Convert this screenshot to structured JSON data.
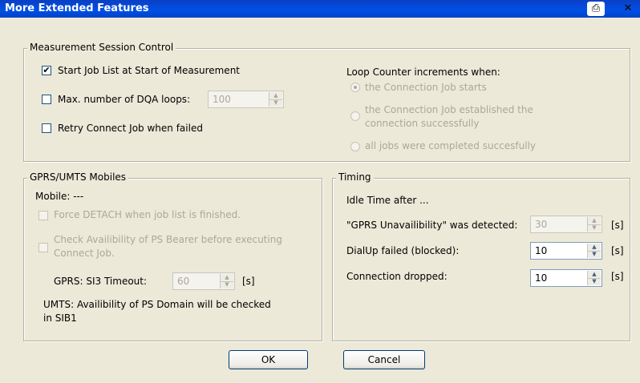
{
  "window": {
    "title": "More Extended Features"
  },
  "measurement": {
    "group_title": "Measurement Session Control",
    "start_job_list": {
      "label": "Start Job List at Start of Measurement",
      "checked": true
    },
    "max_dqa": {
      "label": "Max. number of DQA loops:",
      "checked": false,
      "value": "100"
    },
    "retry_connect": {
      "label": "Retry Connect Job when failed",
      "checked": false
    },
    "loop_counter": {
      "title": "Loop Counter increments when:",
      "options": [
        {
          "label": "the Connection Job starts",
          "selected": true
        },
        {
          "label_line1": "the Connection Job established the",
          "label_line2": "connection successfully",
          "selected": false
        },
        {
          "label": "all jobs were completed succesfully",
          "selected": false
        }
      ]
    }
  },
  "gprs": {
    "group_title": "GPRS/UMTS Mobiles",
    "mobile": "Mobile:  ---",
    "force_detach": "Force DETACH when job list is finished.",
    "check_ps_line1": "Check Availibility of PS Bearer before executing",
    "check_ps_line2": "Connect Job.",
    "si3_label": "GPRS: SI3 Timeout:",
    "si3_value": "60",
    "si3_unit": "[s]",
    "umts_line1": "UMTS: Availibility of PS Domain will be checked",
    "umts_line2": "in SIB1"
  },
  "timing": {
    "group_title": "Timing",
    "idle_label": "Idle Time after ...",
    "rows": [
      {
        "label": "\"GPRS Unavailibility\" was detected:",
        "value": "30",
        "unit": "[s]",
        "disabled": true
      },
      {
        "label": "DialUp failed (blocked):",
        "value": "10",
        "unit": "[s]",
        "disabled": false
      },
      {
        "label": "Connection dropped:",
        "value": "10",
        "unit": "[s]",
        "disabled": false
      }
    ]
  },
  "buttons": {
    "ok": "OK",
    "cancel": "Cancel"
  }
}
